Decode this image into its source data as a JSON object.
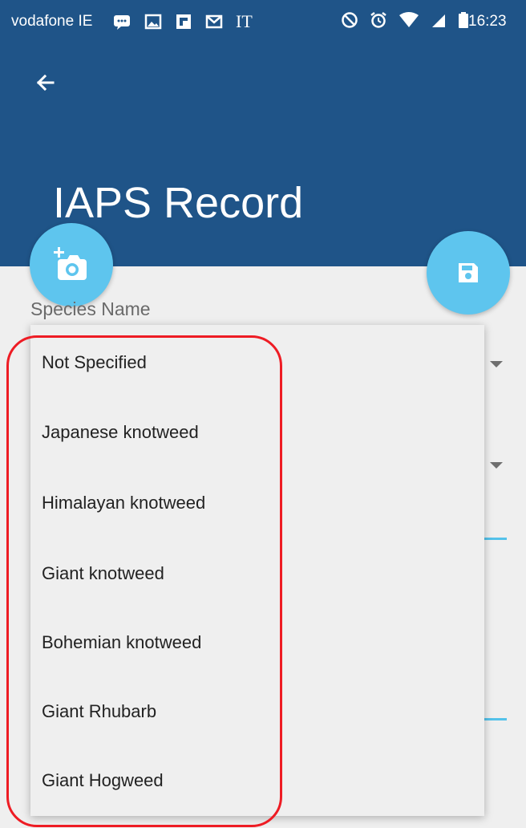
{
  "status_bar": {
    "carrier": "vodafone IE",
    "network_label": "IT",
    "time": "16:23"
  },
  "header": {
    "title": "IAPS Record"
  },
  "form": {
    "species_label": "Species Name"
  },
  "dropdown": {
    "options": [
      "Not Specified",
      "Japanese knotweed",
      "Himalayan knotweed",
      "Giant knotweed",
      "Bohemian knotweed",
      "Giant Rhubarb",
      "Giant Hogweed"
    ]
  },
  "icons": {
    "back": "arrow-left-icon",
    "add_photo": "add-a-photo-icon",
    "save": "floppy-disk-icon"
  },
  "colors": {
    "app_bar": "#1f5488",
    "fab": "#5ec5ee",
    "highlight": "#ee1c24"
  }
}
